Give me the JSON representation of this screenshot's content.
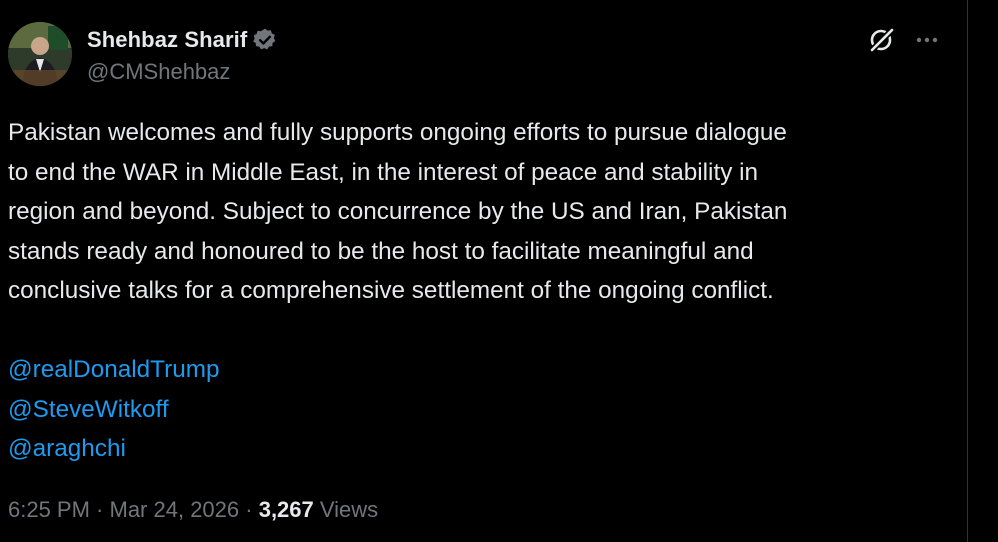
{
  "author": {
    "display_name": "Shehbaz Sharif",
    "handle": "@CMShehbaz",
    "verified": true,
    "verified_color": "#71767b"
  },
  "tweet": {
    "text_lines": [
      "Pakistan welcomes and fully supports ongoing efforts to pursue dialogue",
      "to end the WAR in Middle East, in the interest of peace and stability in",
      "region and beyond. Subject to concurrence by the US and Iran, Pakistan",
      "stands ready and honoured to be the host to facilitate meaningful and",
      "conclusive talks for a comprehensive settlement of the ongoing conflict."
    ],
    "mentions": [
      "@realDonaldTrump",
      "@SteveWitkoff",
      "@araghchi"
    ]
  },
  "meta": {
    "time": "6:25 PM",
    "separator": " · ",
    "date": "Mar 24, 2026",
    "views_count": "3,267",
    "views_label": "Views"
  },
  "icons": {
    "grok": "grok-icon",
    "more": "more-icon",
    "verified": "verified-badge-icon"
  },
  "colors": {
    "background": "#000000",
    "text": "#e7e9ea",
    "secondary": "#71767b",
    "link": "#1d9bf0",
    "divider": "#2f3336"
  }
}
